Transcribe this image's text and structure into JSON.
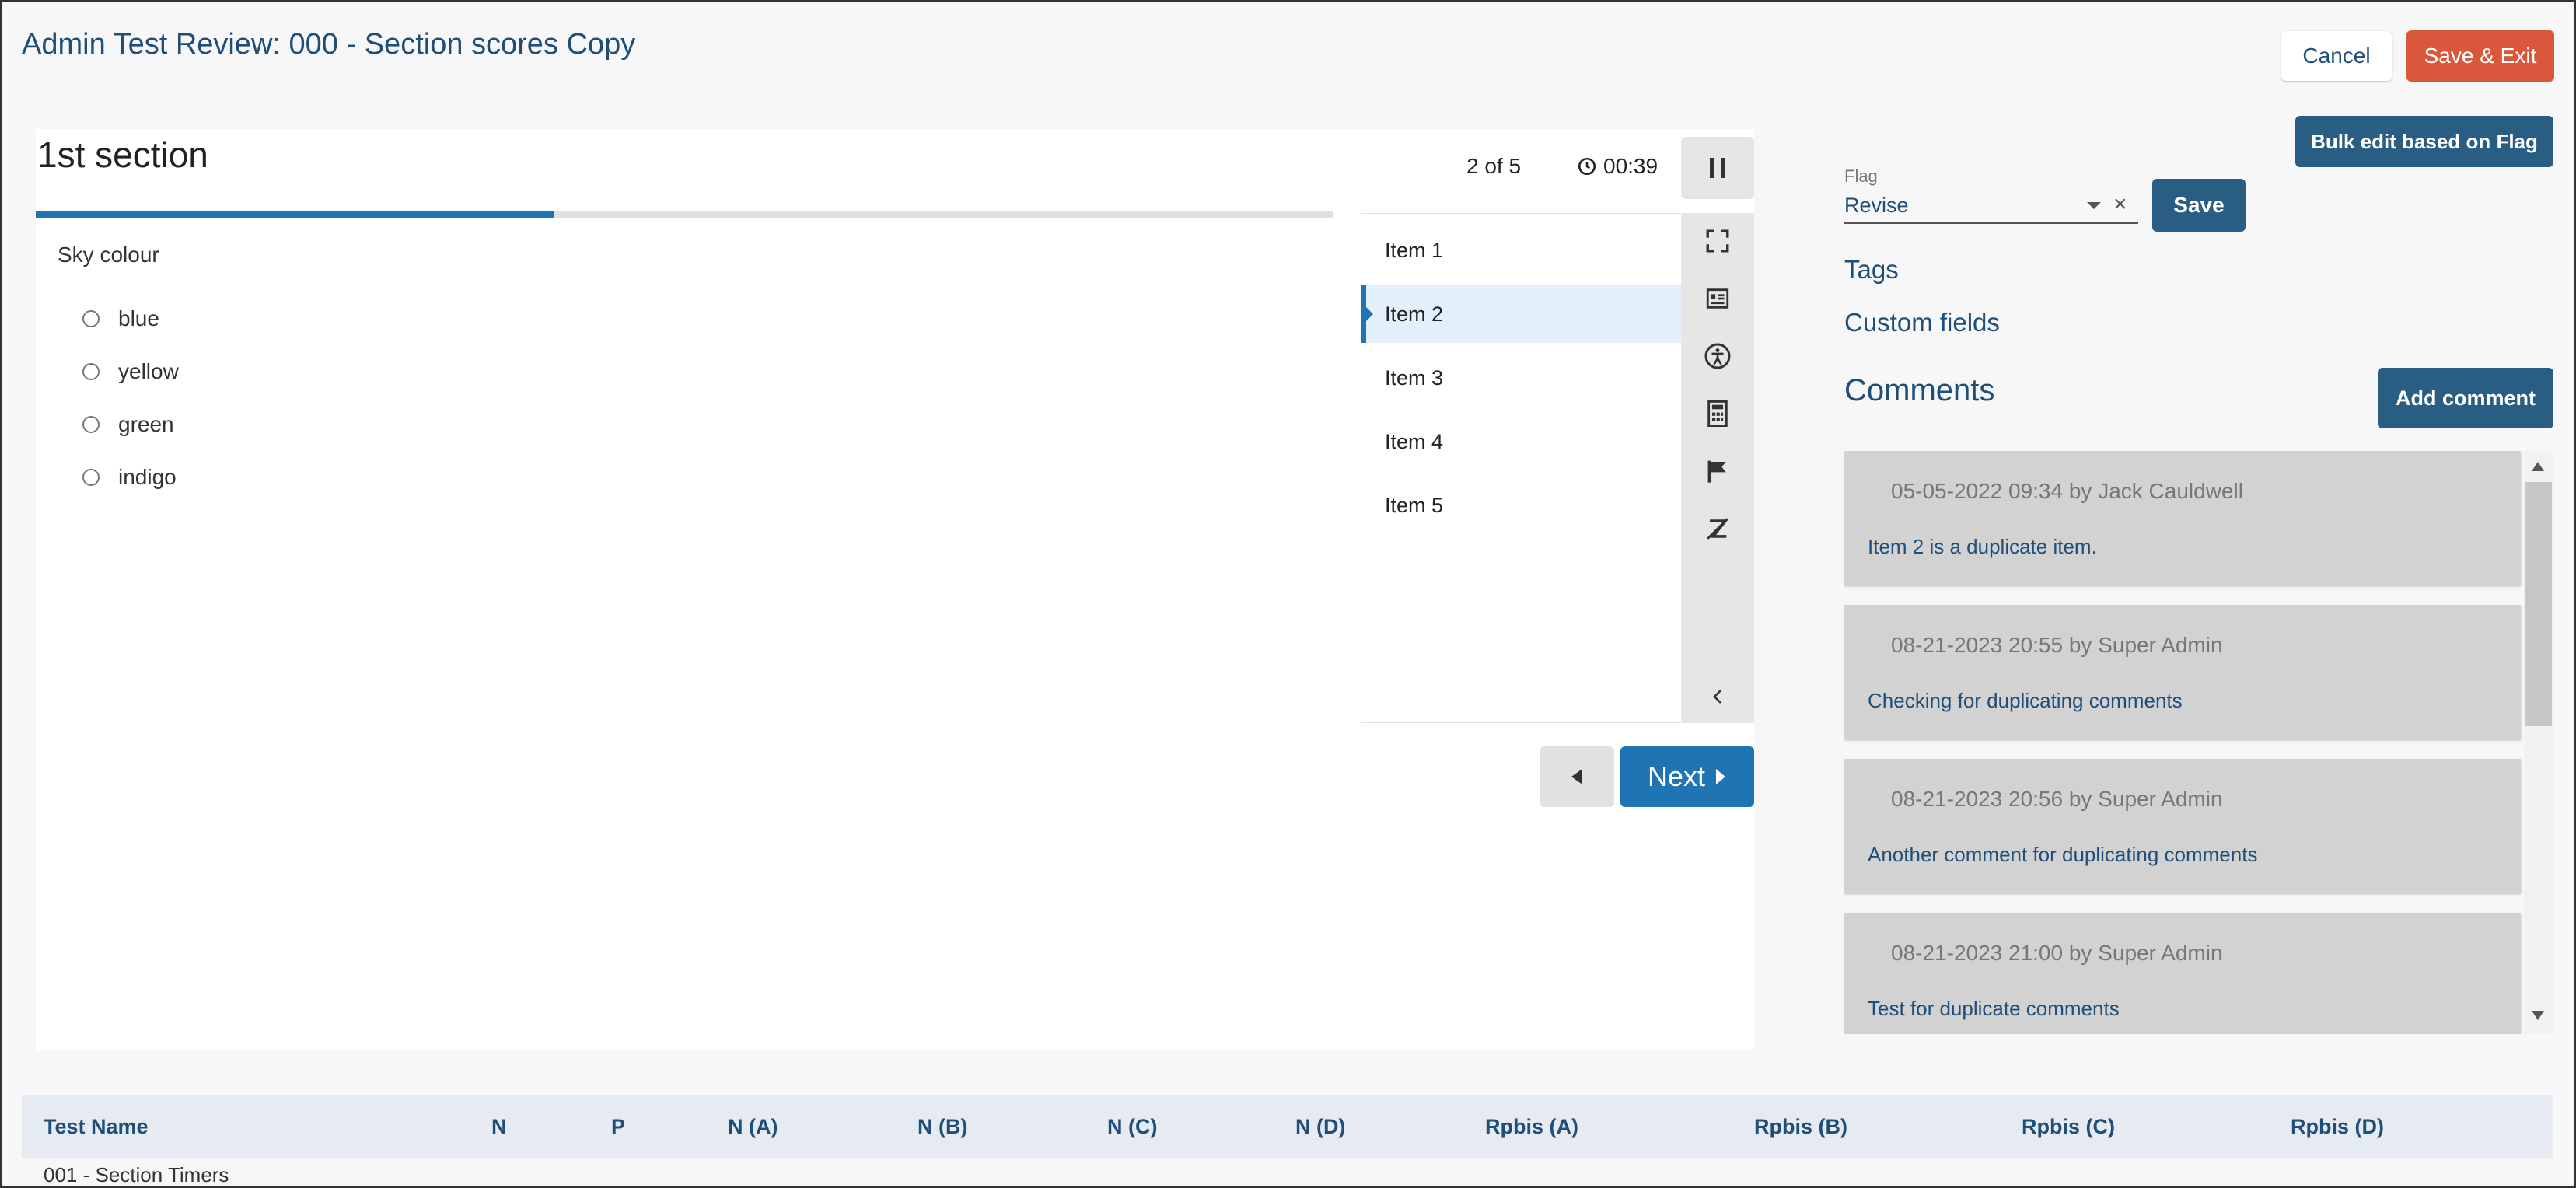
{
  "header": {
    "title": "Admin Test Review: 000 - Section scores Copy",
    "cancel_label": "Cancel",
    "save_exit_label": "Save & Exit"
  },
  "test": {
    "section_title": "1st section",
    "counter": "2 of 5",
    "timer": "00:39",
    "progress_fraction": 0.4,
    "question": "Sky colour",
    "options": [
      "blue",
      "yellow",
      "green",
      "indigo"
    ],
    "items": [
      "Item 1",
      "Item 2",
      "Item 3",
      "Item 4",
      "Item 5"
    ],
    "active_item_index": 1,
    "next_label": "Next",
    "tools": [
      "expand-icon",
      "reference-icon",
      "accessibility-icon",
      "calculator-icon",
      "flag-icon",
      "clear-highlight-icon"
    ]
  },
  "review": {
    "bulk_edit_label": "Bulk edit based on Flag",
    "flag_label": "Flag",
    "flag_value": "Revise",
    "flag_clear": "×",
    "save_label": "Save",
    "tags_label": "Tags",
    "custom_fields_label": "Custom fields",
    "comments_heading": "Comments",
    "add_comment_label": "Add comment",
    "comments": [
      {
        "meta": "05-05-2022 09:34 by Jack Cauldwell",
        "text": "Item 2 is a duplicate item."
      },
      {
        "meta": "08-21-2023 20:55 by Super Admin",
        "text": "Checking for duplicating comments"
      },
      {
        "meta": "08-21-2023 20:56 by Super Admin",
        "text": "Another comment for duplicating comments"
      },
      {
        "meta": "08-21-2023 21:00 by Super Admin",
        "text": "Test for duplicate comments"
      }
    ]
  },
  "stats": {
    "columns": [
      "Test Name",
      "N",
      "P",
      "N (A)",
      "N (B)",
      "N (C)",
      "N (D)",
      "Rpbis (A)",
      "Rpbis (B)",
      "Rpbis (C)",
      "Rpbis (D)"
    ],
    "rows": [
      {
        "test_name": "001 - Section Timers"
      }
    ]
  }
}
